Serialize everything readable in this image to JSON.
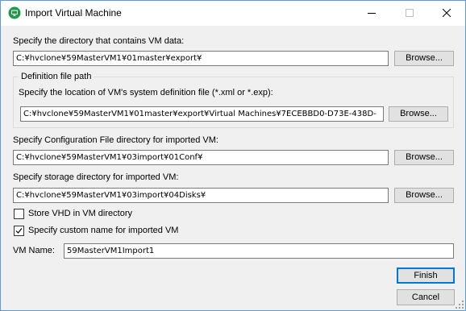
{
  "window": {
    "title": "Import Virtual Machine",
    "accent_color": "#0078d7",
    "icon": "app-monitor-icon"
  },
  "vm_data": {
    "label": "Specify the directory that contains VM data:",
    "value": "C:¥hvclone¥59MasterVM1¥01master¥export¥",
    "browse_label": "Browse..."
  },
  "definition": {
    "group_title": "Definition file path",
    "label": "Specify the location of VM's system definition file (*.xml or *.exp):",
    "value": "C:¥hvclone¥59MasterVM1¥01master¥export¥Virtual Machines¥7ECEBBD0-D73E-438D-",
    "browse_label": "Browse..."
  },
  "config_dir": {
    "label": "Specify Configuration File directory for imported VM:",
    "value": "C:¥hvclone¥59MasterVM1¥03import¥01Conf¥",
    "browse_label": "Browse..."
  },
  "storage_dir": {
    "label": "Specify storage directory for imported VM:",
    "value": "C:¥hvclone¥59MasterVM1¥03import¥04Disks¥",
    "browse_label": "Browse..."
  },
  "options": {
    "store_vhd_label": "Store VHD in VM directory",
    "store_vhd_checked": false,
    "custom_name_label": "Specify custom name for imported VM",
    "custom_name_checked": true
  },
  "vm_name": {
    "label": "VM Name:",
    "value": "59MasterVM1Import1"
  },
  "footer": {
    "finish_label": "Finish",
    "cancel_label": "Cancel"
  }
}
